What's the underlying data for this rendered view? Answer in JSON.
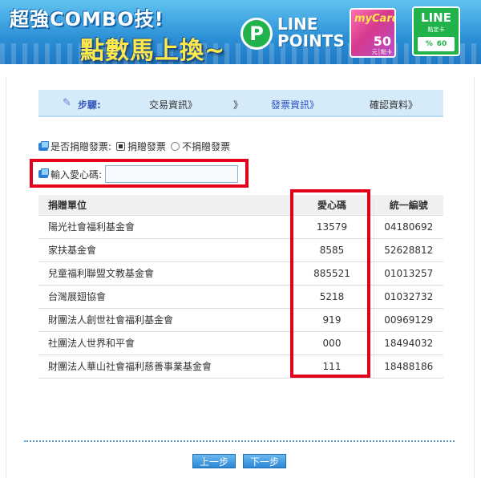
{
  "banner": {
    "title_line1": "超強COMBO技!",
    "title_line2": "點數馬上換~",
    "line_points_badge": "P",
    "line_points_text": "LINE POINTS",
    "mycard_logo": "myCard",
    "mycard_value": "50",
    "mycard_unit": "元│點卡",
    "line_logo": "LINE",
    "line_sub": "點定卡",
    "line_percent": "%",
    "line_value": "60",
    "colors": {
      "sky": "#2b8fd6",
      "yellow": "#ffe84a",
      "line_green": "#22b24c"
    }
  },
  "steps": {
    "label": "步驟:",
    "step1": "交易資訊》",
    "separator": "》",
    "step2": "發票資訊》",
    "step3": "確認資料》",
    "active_color": "#2a4fbf"
  },
  "donate": {
    "question": "是否捐贈發票:",
    "option_yes": "捐贈發票",
    "option_no": "不捐贈發票",
    "selected": "捐贈發票"
  },
  "love_code": {
    "label": "輸入愛心碼:",
    "value": "",
    "placeholder": ""
  },
  "table": {
    "headers": [
      "捐贈單位",
      "愛心碼",
      "統一編號"
    ],
    "rows": [
      [
        "陽光社會福利基金會",
        "13579",
        "04180692"
      ],
      [
        "家扶基金會",
        "8585",
        "52628812"
      ],
      [
        "兒童福利聯盟文教基金會",
        "885521",
        "01013257"
      ],
      [
        "台灣展翅協會",
        "5218",
        "01032732"
      ],
      [
        "財團法人創世社會福利基金會",
        "919",
        "00969129"
      ],
      [
        "社團法人世界和平會",
        "000",
        "18494032"
      ],
      [
        "財團法人華山社會福利慈善事業基金會",
        "111",
        "18488186"
      ]
    ]
  },
  "buttons": {
    "prev": "上一步",
    "next": "下一步"
  },
  "highlight_color": "#e2001a"
}
